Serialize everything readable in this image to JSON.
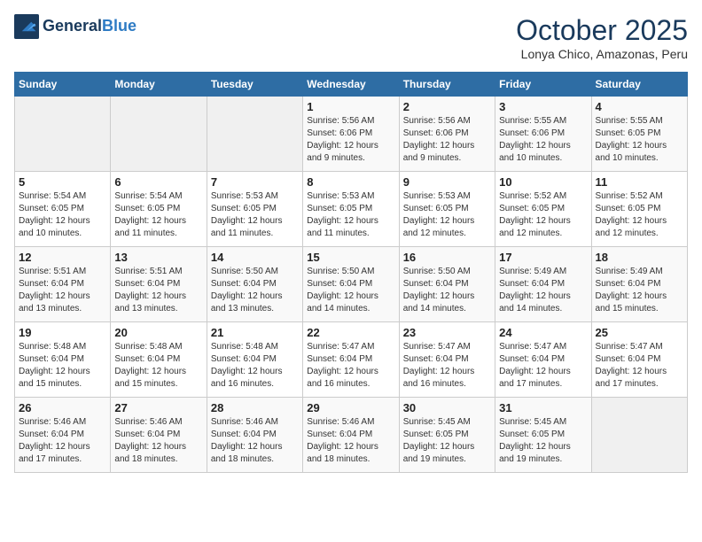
{
  "header": {
    "logo_line1": "General",
    "logo_line2": "Blue",
    "month": "October 2025",
    "location": "Lonya Chico, Amazonas, Peru"
  },
  "weekdays": [
    "Sunday",
    "Monday",
    "Tuesday",
    "Wednesday",
    "Thursday",
    "Friday",
    "Saturday"
  ],
  "weeks": [
    [
      {
        "day": "",
        "info": ""
      },
      {
        "day": "",
        "info": ""
      },
      {
        "day": "",
        "info": ""
      },
      {
        "day": "1",
        "info": "Sunrise: 5:56 AM\nSunset: 6:06 PM\nDaylight: 12 hours and 9 minutes."
      },
      {
        "day": "2",
        "info": "Sunrise: 5:56 AM\nSunset: 6:06 PM\nDaylight: 12 hours and 9 minutes."
      },
      {
        "day": "3",
        "info": "Sunrise: 5:55 AM\nSunset: 6:06 PM\nDaylight: 12 hours and 10 minutes."
      },
      {
        "day": "4",
        "info": "Sunrise: 5:55 AM\nSunset: 6:05 PM\nDaylight: 12 hours and 10 minutes."
      }
    ],
    [
      {
        "day": "5",
        "info": "Sunrise: 5:54 AM\nSunset: 6:05 PM\nDaylight: 12 hours and 10 minutes."
      },
      {
        "day": "6",
        "info": "Sunrise: 5:54 AM\nSunset: 6:05 PM\nDaylight: 12 hours and 11 minutes."
      },
      {
        "day": "7",
        "info": "Sunrise: 5:53 AM\nSunset: 6:05 PM\nDaylight: 12 hours and 11 minutes."
      },
      {
        "day": "8",
        "info": "Sunrise: 5:53 AM\nSunset: 6:05 PM\nDaylight: 12 hours and 11 minutes."
      },
      {
        "day": "9",
        "info": "Sunrise: 5:53 AM\nSunset: 6:05 PM\nDaylight: 12 hours and 12 minutes."
      },
      {
        "day": "10",
        "info": "Sunrise: 5:52 AM\nSunset: 6:05 PM\nDaylight: 12 hours and 12 minutes."
      },
      {
        "day": "11",
        "info": "Sunrise: 5:52 AM\nSunset: 6:05 PM\nDaylight: 12 hours and 12 minutes."
      }
    ],
    [
      {
        "day": "12",
        "info": "Sunrise: 5:51 AM\nSunset: 6:04 PM\nDaylight: 12 hours and 13 minutes."
      },
      {
        "day": "13",
        "info": "Sunrise: 5:51 AM\nSunset: 6:04 PM\nDaylight: 12 hours and 13 minutes."
      },
      {
        "day": "14",
        "info": "Sunrise: 5:50 AM\nSunset: 6:04 PM\nDaylight: 12 hours and 13 minutes."
      },
      {
        "day": "15",
        "info": "Sunrise: 5:50 AM\nSunset: 6:04 PM\nDaylight: 12 hours and 14 minutes."
      },
      {
        "day": "16",
        "info": "Sunrise: 5:50 AM\nSunset: 6:04 PM\nDaylight: 12 hours and 14 minutes."
      },
      {
        "day": "17",
        "info": "Sunrise: 5:49 AM\nSunset: 6:04 PM\nDaylight: 12 hours and 14 minutes."
      },
      {
        "day": "18",
        "info": "Sunrise: 5:49 AM\nSunset: 6:04 PM\nDaylight: 12 hours and 15 minutes."
      }
    ],
    [
      {
        "day": "19",
        "info": "Sunrise: 5:48 AM\nSunset: 6:04 PM\nDaylight: 12 hours and 15 minutes."
      },
      {
        "day": "20",
        "info": "Sunrise: 5:48 AM\nSunset: 6:04 PM\nDaylight: 12 hours and 15 minutes."
      },
      {
        "day": "21",
        "info": "Sunrise: 5:48 AM\nSunset: 6:04 PM\nDaylight: 12 hours and 16 minutes."
      },
      {
        "day": "22",
        "info": "Sunrise: 5:47 AM\nSunset: 6:04 PM\nDaylight: 12 hours and 16 minutes."
      },
      {
        "day": "23",
        "info": "Sunrise: 5:47 AM\nSunset: 6:04 PM\nDaylight: 12 hours and 16 minutes."
      },
      {
        "day": "24",
        "info": "Sunrise: 5:47 AM\nSunset: 6:04 PM\nDaylight: 12 hours and 17 minutes."
      },
      {
        "day": "25",
        "info": "Sunrise: 5:47 AM\nSunset: 6:04 PM\nDaylight: 12 hours and 17 minutes."
      }
    ],
    [
      {
        "day": "26",
        "info": "Sunrise: 5:46 AM\nSunset: 6:04 PM\nDaylight: 12 hours and 17 minutes."
      },
      {
        "day": "27",
        "info": "Sunrise: 5:46 AM\nSunset: 6:04 PM\nDaylight: 12 hours and 18 minutes."
      },
      {
        "day": "28",
        "info": "Sunrise: 5:46 AM\nSunset: 6:04 PM\nDaylight: 12 hours and 18 minutes."
      },
      {
        "day": "29",
        "info": "Sunrise: 5:46 AM\nSunset: 6:04 PM\nDaylight: 12 hours and 18 minutes."
      },
      {
        "day": "30",
        "info": "Sunrise: 5:45 AM\nSunset: 6:05 PM\nDaylight: 12 hours and 19 minutes."
      },
      {
        "day": "31",
        "info": "Sunrise: 5:45 AM\nSunset: 6:05 PM\nDaylight: 12 hours and 19 minutes."
      },
      {
        "day": "",
        "info": ""
      }
    ]
  ]
}
